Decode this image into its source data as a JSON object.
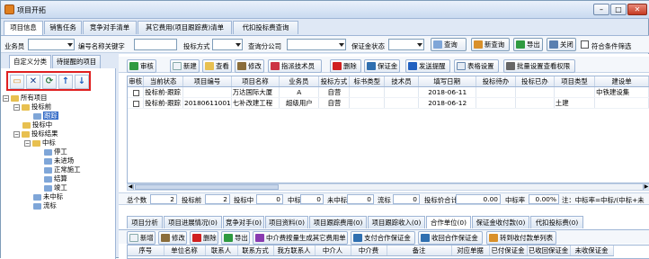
{
  "window": {
    "title": "项目开拓",
    "btn_min": "–",
    "btn_max": "□",
    "btn_close": "✕"
  },
  "tabs": [
    "项目信息",
    "销售任务",
    "竞争对手清单",
    "其它费用(项目跟踪费)清单",
    "代扣投标费查询"
  ],
  "filter": {
    "salesperson_label": "业务员",
    "salesperson_value": "",
    "number_label": "编号名称关键字",
    "number_value": "",
    "bid_method_label": "投标方式",
    "bid_method_value": "",
    "query_company_label": "查询分公司",
    "query_company_value": "",
    "deposit_status_label": "保证金状态",
    "deposit_status_value": "",
    "query_button": "查询",
    "new_query_button": "新查询",
    "export_button": "导出",
    "close_button": "关闭",
    "match_label": "符合条件筛选"
  },
  "left_panel": {
    "tabs": [
      "自定义分类",
      "待提醒的项目"
    ],
    "toolbar_icons": [
      "folder-icon",
      "delete-icon",
      "refresh-icon",
      "move-up-icon",
      "move-down-icon"
    ],
    "tree": [
      {
        "label": "所有项目",
        "level": 0,
        "expanded": true
      },
      {
        "label": "投标前",
        "level": 1,
        "expanded": true
      },
      {
        "label": "跟踪",
        "level": 2,
        "selected": true
      },
      {
        "label": "投标中",
        "level": 1
      },
      {
        "label": "投标结果",
        "level": 1,
        "expanded": true
      },
      {
        "label": "中标",
        "level": 2,
        "expanded": true
      },
      {
        "label": "停工",
        "level": 3
      },
      {
        "label": "未进场",
        "level": 3
      },
      {
        "label": "正常施工",
        "level": 3
      },
      {
        "label": "结算",
        "level": 3
      },
      {
        "label": "竣工",
        "level": 3
      },
      {
        "label": "未中标",
        "level": 2
      },
      {
        "label": "流标",
        "level": 2
      }
    ]
  },
  "toolbar": {
    "review": "审核",
    "new": "新建",
    "view": "查看",
    "edit": "修改",
    "assign": "指派技术员",
    "delete": "删除",
    "deposit": "保证金",
    "remind": "发送提醒",
    "table_settings": "表格设置",
    "batch_permission": "批量设置查看权限"
  },
  "grid": {
    "columns": [
      "审核",
      "当前状态",
      "项目编号",
      "项目名称",
      "业务员",
      "投标方式",
      "标书类型",
      "技术员",
      "填写日期",
      "投标待办",
      "投标已办",
      "项目类型",
      "建设单"
    ],
    "rows": [
      {
        "status": "投标前-跟踪",
        "code": "",
        "name": "万达国际大厦",
        "sales": "A",
        "method": "自营",
        "doc_type": "",
        "tech": "",
        "date": "2018-06-11",
        "todo": "",
        "done": "",
        "ptype": "",
        "builder": "中铁建设集"
      },
      {
        "status": "投标前-跟踪",
        "code": "20180611001",
        "name": "七补改建工程",
        "sales": "超级用户",
        "method": "自营",
        "doc_type": "",
        "tech": "",
        "date": "2018-06-12",
        "todo": "",
        "done": "",
        "ptype": "土建",
        "builder": ""
      }
    ]
  },
  "summary": {
    "total_label": "总个数",
    "total": "2",
    "before_label": "投标前",
    "before": "2",
    "during_label": "投标中",
    "during": "0",
    "won_label": "中标",
    "won": "0",
    "lost_label": "未中标",
    "lost": "0",
    "failed_label": "流标",
    "failed": "0",
    "price_label": "投标价合计",
    "price": "0.00",
    "rate_label": "中标率",
    "rate": "0.00%",
    "note": "注：中标率=中标/(中标+未"
  },
  "subtabs": [
    "项目分析",
    "项目进展情况(0)",
    "竞争对手(0)",
    "项目资料(0)",
    "项目跟踪费用(0)",
    "项目跟踪收入(0)",
    "合作单位(0)",
    "保证金收付款(0)",
    "代扣投标费(0)"
  ],
  "subtoolbar": {
    "new": "新增",
    "edit": "修改",
    "delete": "删除",
    "export": "导出",
    "generate": "中介费按量生成其它费用单",
    "pay_deposit": "支付合作保证金",
    "recv_deposit": "收回合作保证金",
    "transfer": "转到收付款单列表"
  },
  "subgrid": {
    "columns": [
      "序号",
      "单位名称",
      "联系人",
      "联系方式",
      "我方联系人",
      "中介人",
      "中介费",
      "备注",
      "对应单据",
      "已付保证金",
      "已收回保证金",
      "未收保证金"
    ]
  },
  "colors": {
    "accent": "#3169c6",
    "highlight_border": "#e02020",
    "window_bg": "#dfe8f5"
  }
}
